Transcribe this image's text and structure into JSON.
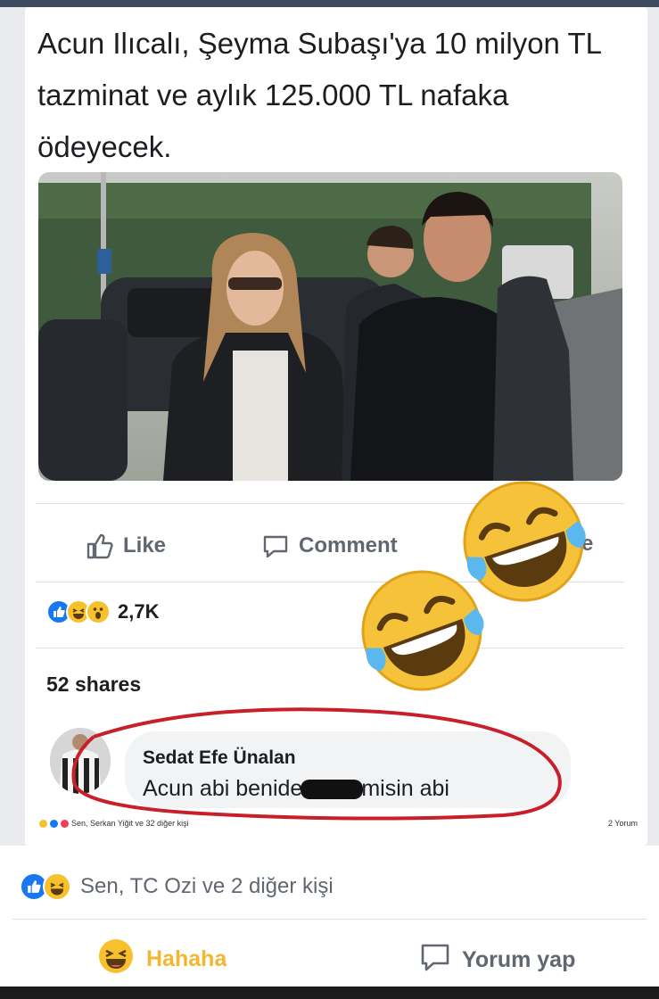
{
  "post": {
    "headline": "Acun Ilıcalı, Şeyma Subaşı'ya 10 milyon TL tazminat ve aylık 125.000 TL nafaka ödeyecek."
  },
  "actions": {
    "like": "Like",
    "comment": "Comment",
    "share_partial": "e"
  },
  "reactions": {
    "count": "2,7K",
    "icons": [
      "like-icon",
      "haha-icon",
      "wow-icon"
    ]
  },
  "shares": "52 shares",
  "comment": {
    "author": "Sedat Efe Ünalan",
    "text_before": "Acun abi benide",
    "text_after": "misin abi"
  },
  "inner_footer": {
    "reactors": "Sen, Serkan Yiğit ve 32 diğer kişi",
    "comments_count": "2 Yorum"
  },
  "outer": {
    "reactors": "Sen, TC Ozi ve 2 diğer kişi",
    "haha_button": "Hahaha",
    "comment_button": "Yorum yap"
  },
  "colors": {
    "like_blue": "#1877f2",
    "haha_yellow": "#f2b630",
    "muted_text": "#606770",
    "annotation_red": "#c8202a"
  }
}
